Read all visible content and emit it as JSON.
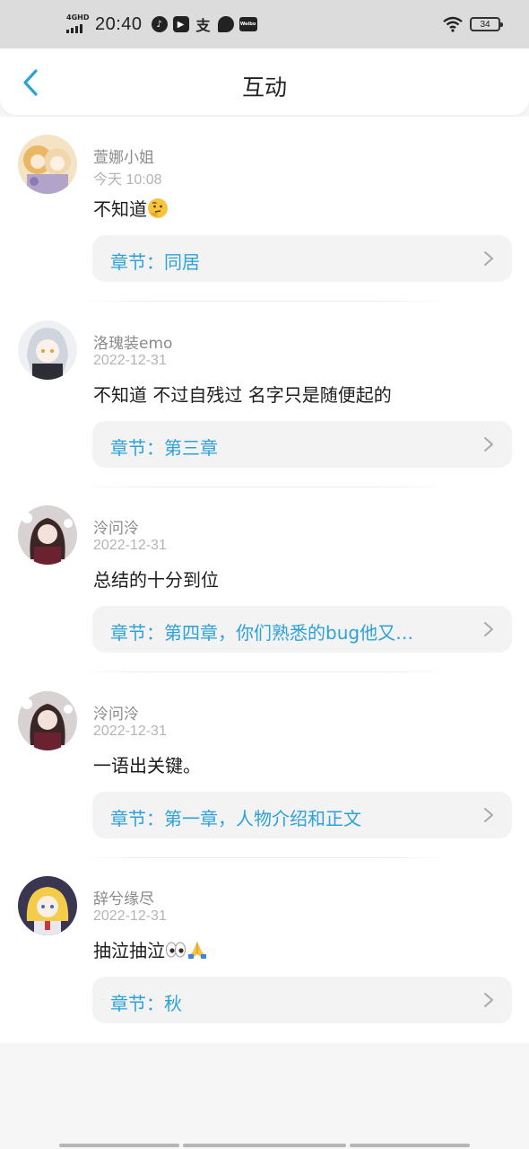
{
  "status_bar": {
    "network": "4GHD",
    "time": "20:40",
    "battery": "34",
    "icons": [
      "tiktok-icon",
      "video-icon",
      "app-icon",
      "chat-icon",
      "weather-icon",
      "wifi-icon",
      "battery-icon"
    ]
  },
  "header": {
    "title": "互动",
    "back_icon": "chevron-left-icon"
  },
  "colors": {
    "accent": "#2ea2d8",
    "username": "#8a8a8a",
    "date": "#b4b4b4",
    "chapter_bg": "#f3f3f3"
  },
  "comments": [
    {
      "username": "萱娜小姐",
      "date": "今天 10:08",
      "content": "不知道",
      "content_emoji": [
        "thinking-face-emoji"
      ],
      "chapter": "章节：同居"
    },
    {
      "username": "洛瑰装emo",
      "date": "2022-12-31",
      "content": "不知道 不过自残过 名字只是随便起的",
      "content_emoji": [],
      "chapter": "章节：第三章"
    },
    {
      "username": "泠问泠",
      "date": "2022-12-31",
      "content": "总结的十分到位",
      "content_emoji": [],
      "chapter": "章节：第四章，你们熟悉的bug他又…"
    },
    {
      "username": "泠问泠",
      "date": "2022-12-31",
      "content": "一语出关键。",
      "content_emoji": [],
      "chapter": "章节：第一章，人物介绍和正文"
    },
    {
      "username": "辞兮缘尽",
      "date": "2022-12-31",
      "content": "抽泣抽泣",
      "content_emoji": [
        "eyes-emoji",
        "folded-hands-emoji"
      ],
      "chapter": "章节：秋"
    }
  ]
}
